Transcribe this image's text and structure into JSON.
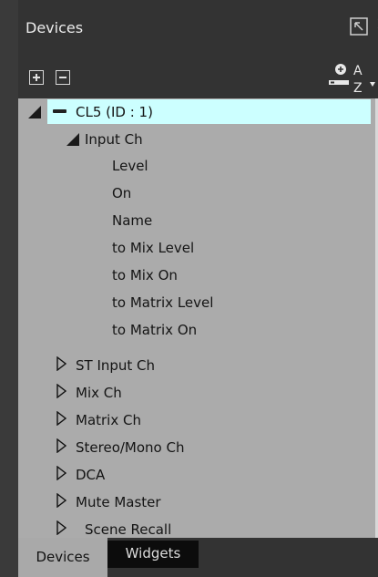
{
  "panel": {
    "title": "Devices"
  },
  "toolbar": {
    "expand_icon": "plus-box-icon",
    "collapse_icon": "minus-box-icon",
    "sort_icon": "add-device-sort-az-icon"
  },
  "tree": {
    "device": {
      "label": "CL5 (ID : 1)",
      "expanded": true,
      "selected": true
    },
    "input_ch": {
      "label": "Input Ch",
      "expanded": true,
      "children": [
        "Level",
        "On",
        "Name",
        "to Mix Level",
        "to Mix On",
        "to Matrix Level",
        "to Matrix On"
      ]
    },
    "groups": [
      "ST Input Ch",
      "Mix Ch",
      "Matrix Ch",
      "Stereo/Mono Ch",
      "DCA",
      "Mute Master",
      "Scene Recall"
    ]
  },
  "tabs": [
    {
      "label": "Devices",
      "active": true
    },
    {
      "label": "Widgets",
      "active": false
    }
  ],
  "colors": {
    "selection": "#ccffff",
    "tree_bg": "#ababab",
    "chrome_bg": "#333333"
  }
}
